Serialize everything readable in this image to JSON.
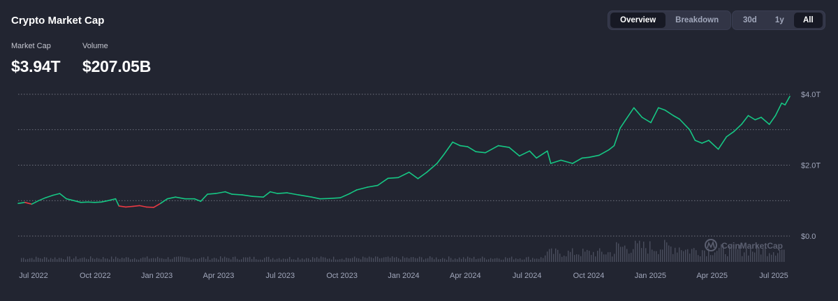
{
  "title": "Crypto Market Cap",
  "metrics": {
    "market_cap": {
      "label": "Market Cap",
      "value": "$3.94T"
    },
    "volume": {
      "label": "Volume",
      "value": "$207.05B"
    }
  },
  "view_toggle": {
    "options": [
      "Overview",
      "Breakdown"
    ],
    "active": "Overview"
  },
  "range_toggle": {
    "options": [
      "30d",
      "1y",
      "All"
    ],
    "active": "All"
  },
  "watermark": "CoinMarketCap",
  "colors": {
    "up": "#16c784",
    "down": "#ea3943",
    "grid": "#8a8d99",
    "background": "#222531"
  },
  "chart_data": {
    "type": "line",
    "title": "",
    "xlabel": "",
    "ylabel": "",
    "ylim": [
      0,
      4.0
    ],
    "y_ticks": [
      {
        "value": 0,
        "label": "$0.0"
      },
      {
        "value": 2.0,
        "label": "$2.0T"
      },
      {
        "value": 4.0,
        "label": "$4.0T"
      }
    ],
    "x_ticks": [
      "Jul 2022",
      "Oct 2022",
      "Jan 2023",
      "Apr 2023",
      "Jul 2023",
      "Oct 2023",
      "Jan 2024",
      "Apr 2024",
      "Jul 2024",
      "Oct 2024",
      "Jan 2025",
      "Apr 2025",
      "Jul 2025"
    ],
    "x_range": [
      "2022-06-15",
      "2025-07-22"
    ],
    "grid": true,
    "series": [
      {
        "unit": "T USD",
        "x": [
          "2022-06-15",
          "2022-06-25",
          "2022-07-05",
          "2022-07-15",
          "2022-07-25",
          "2022-08-05",
          "2022-08-15",
          "2022-08-25",
          "2022-09-05",
          "2022-09-15",
          "2022-09-25",
          "2022-10-05",
          "2022-10-15",
          "2022-10-25",
          "2022-11-05",
          "2022-11-10",
          "2022-11-20",
          "2022-12-01",
          "2022-12-10",
          "2022-12-20",
          "2022-12-31",
          "2023-01-10",
          "2023-01-20",
          "2023-02-01",
          "2023-02-15",
          "2023-03-01",
          "2023-03-10",
          "2023-03-20",
          "2023-04-01",
          "2023-04-15",
          "2023-04-25",
          "2023-05-10",
          "2023-05-25",
          "2023-06-10",
          "2023-06-20",
          "2023-07-01",
          "2023-07-15",
          "2023-08-01",
          "2023-08-20",
          "2023-09-01",
          "2023-09-15",
          "2023-10-01",
          "2023-10-15",
          "2023-10-25",
          "2023-11-10",
          "2023-11-25",
          "2023-12-10",
          "2023-12-25",
          "2024-01-10",
          "2024-01-23",
          "2024-02-05",
          "2024-02-20",
          "2024-03-01",
          "2024-03-14",
          "2024-03-25",
          "2024-04-05",
          "2024-04-17",
          "2024-05-01",
          "2024-05-20",
          "2024-06-05",
          "2024-06-20",
          "2024-07-05",
          "2024-07-15",
          "2024-07-31",
          "2024-08-05",
          "2024-08-20",
          "2024-09-06",
          "2024-09-20",
          "2024-09-30",
          "2024-10-15",
          "2024-10-29",
          "2024-11-06",
          "2024-11-15",
          "2024-11-22",
          "2024-12-05",
          "2024-12-17",
          "2024-12-30",
          "2025-01-10",
          "2025-01-20",
          "2025-02-01",
          "2025-02-10",
          "2025-02-25",
          "2025-03-05",
          "2025-03-15",
          "2025-03-25",
          "2025-04-08",
          "2025-04-20",
          "2025-05-01",
          "2025-05-12",
          "2025-05-22",
          "2025-06-01",
          "2025-06-10",
          "2025-06-22",
          "2025-07-01",
          "2025-07-10",
          "2025-07-15",
          "2025-07-22"
        ],
        "values": [
          0.92,
          0.95,
          0.9,
          1.0,
          1.08,
          1.15,
          1.2,
          1.05,
          1.0,
          0.95,
          0.96,
          0.95,
          0.96,
          1.0,
          1.05,
          0.85,
          0.82,
          0.84,
          0.86,
          0.82,
          0.81,
          0.92,
          1.05,
          1.1,
          1.05,
          1.05,
          0.98,
          1.18,
          1.2,
          1.25,
          1.18,
          1.16,
          1.12,
          1.1,
          1.25,
          1.2,
          1.22,
          1.16,
          1.1,
          1.05,
          1.06,
          1.08,
          1.2,
          1.3,
          1.38,
          1.43,
          1.63,
          1.65,
          1.8,
          1.62,
          1.8,
          2.05,
          2.3,
          2.65,
          2.55,
          2.52,
          2.38,
          2.35,
          2.55,
          2.5,
          2.26,
          2.4,
          2.2,
          2.4,
          2.05,
          2.14,
          2.05,
          2.2,
          2.22,
          2.28,
          2.43,
          2.55,
          3.05,
          3.25,
          3.62,
          3.35,
          3.2,
          3.62,
          3.55,
          3.4,
          3.3,
          3.0,
          2.7,
          2.62,
          2.7,
          2.45,
          2.8,
          2.95,
          3.15,
          3.4,
          3.28,
          3.35,
          3.15,
          3.4,
          3.75,
          3.7,
          3.94
        ],
        "negative_segments": [
          [
            "2022-06-25",
            "2022-07-05"
          ],
          [
            "2022-11-10",
            "2023-01-10"
          ]
        ]
      }
    ]
  }
}
